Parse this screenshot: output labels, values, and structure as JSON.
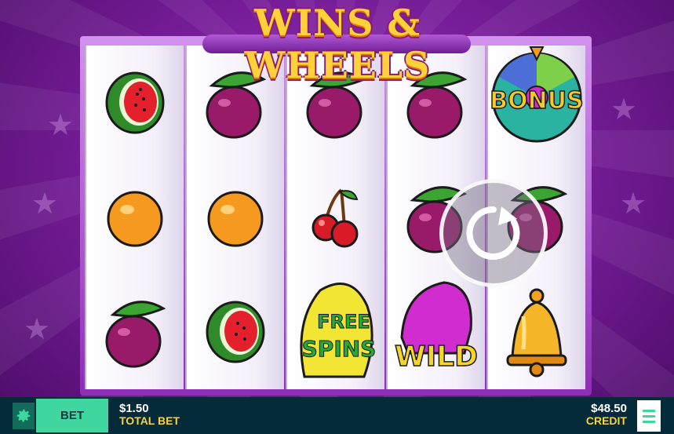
{
  "game": {
    "title": "WINS & WHEELS"
  },
  "reels": [
    [
      "watermelon",
      "orange",
      "plum"
    ],
    [
      "plum",
      "orange",
      "watermelon"
    ],
    [
      "plum",
      "cherries",
      "free-spins"
    ],
    [
      "plum",
      "plum",
      "wild"
    ],
    [
      "bonus-wheel",
      "plum",
      "bell"
    ]
  ],
  "symbols": {
    "free_spins_line1": "FREE",
    "free_spins_line2": "SPINS",
    "wild_text": "WILD",
    "bonus_text": "BONUS"
  },
  "bottom_bar": {
    "bet_button_label": "BET",
    "total_bet_value": "$1.50",
    "total_bet_label": "TOTAL BET",
    "credit_value": "$48.50",
    "credit_label": "CREDIT"
  },
  "icons": {
    "settings": "gear-icon",
    "spin": "spin-icon",
    "menu": "hamburger-icon"
  },
  "colors": {
    "accent_green": "#3fd79f",
    "bar_bg": "#052a3a",
    "label_yellow": "#f3d34a"
  }
}
